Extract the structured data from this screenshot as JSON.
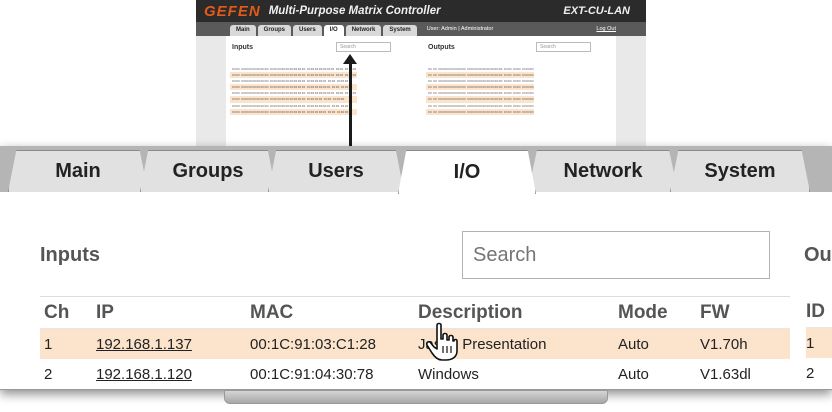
{
  "mini": {
    "brand": "GEFEN",
    "title": "Multi-Purpose Matrix Controller",
    "model": "EXT-CU-LAN",
    "tabs": [
      "Main",
      "Groups",
      "Users",
      "I/O",
      "Network",
      "System"
    ],
    "user_text": "User: Admin  |  Administrator",
    "logout": "Log Out",
    "inputs_label": "Inputs",
    "outputs_label": "Outputs",
    "search_placeholder": "Search"
  },
  "zoom": {
    "tabs": [
      {
        "label": "Main"
      },
      {
        "label": "Groups"
      },
      {
        "label": "Users"
      },
      {
        "label": "I/O"
      },
      {
        "label": "Network"
      },
      {
        "label": "System"
      }
    ],
    "active_tab": "I/O",
    "inputs_title": "Inputs",
    "outputs_title": "Ou",
    "search_placeholder": "Search",
    "columns": [
      "Ch",
      "IP",
      "MAC",
      "Description",
      "Mode",
      "FW"
    ],
    "id_header": "ID",
    "rows": [
      {
        "ch": "1",
        "ip": "192.168.1.137",
        "mac": "00:1C:91:03:C1:28",
        "desc": "Jason Presentation",
        "mode": "Auto",
        "fw": "V1.70h",
        "id": "1"
      },
      {
        "ch": "2",
        "ip": "192.168.1.120",
        "mac": "00:1C:91:04:30:78",
        "desc": "Windows",
        "mode": "Auto",
        "fw": "V1.63dl",
        "id": "2"
      }
    ]
  },
  "colors": {
    "row_highlight": "#fbe3cc",
    "brand_orange": "#e35b1b",
    "header_dark": "#2b2b2b"
  }
}
